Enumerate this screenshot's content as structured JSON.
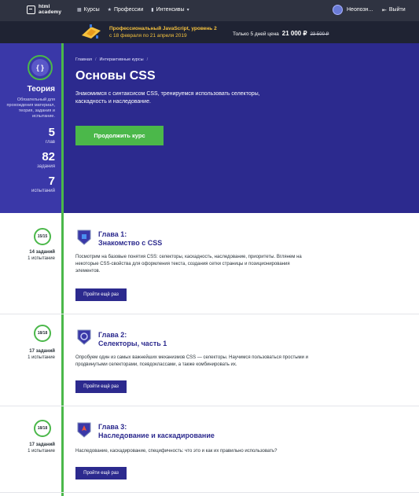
{
  "nav": {
    "logo_line1": "html",
    "logo_line2": "academy",
    "links": [
      {
        "label": "Курсы",
        "icon": "grid-icon"
      },
      {
        "label": "Профессии",
        "icon": "star-icon"
      },
      {
        "label": "Интенсивы",
        "icon": "bookmark-icon",
        "has_dropdown": true
      }
    ],
    "user_name": "Неопозн...",
    "logout_label": "Выйти"
  },
  "promo": {
    "title": "Профессиональный JavaScript, уровень 2",
    "dates": "с 18 февраля по 21 апреля 2019",
    "offer_text": "Только 5 дней цена",
    "price": "21 000 ₽",
    "old_price": "23 500 ₽"
  },
  "theory": {
    "badge": "{ }",
    "title": "Теория",
    "description": "Обязательный для прохождения материал, теория, задания и испытание.",
    "stats": [
      {
        "value": "5",
        "label": "глав"
      },
      {
        "value": "82",
        "label": "задания"
      },
      {
        "value": "7",
        "label": "испытаний"
      }
    ]
  },
  "hero": {
    "breadcrumbs": [
      "Главная",
      "Интерактивные курсы"
    ],
    "title": "Основы CSS",
    "description": "Знакомимся с синтаксисом CSS, тренируемся использовать селекторы, каскадность и наследование.",
    "continue_label": "Продолжить курс"
  },
  "chapters": [
    {
      "progress": "15/15",
      "tasks": "14 заданий",
      "tests": "1 испытание",
      "number": "Глава 1:",
      "name": "Знакомство с CSS",
      "description": "Посмотрим на базовые понятия CSS: селекторы, каскадность, наследование, приоритеты. Вглянем на некоторые CSS-свойства для оформления текста, создания сетки страницы и позиционирования элементов.",
      "button": "Пройти ещё раз",
      "icon": "html5-shield-icon"
    },
    {
      "progress": "18/18",
      "tasks": "17 заданий",
      "tests": "1 испытание",
      "number": "Глава 2:",
      "name": "Селекторы, часть 1",
      "description": "Опробуем один из самых важнейших механизмов CSS — селекторы. Научимся пользоваться простыми и продвинутыми селекторами, псевдоклассами, а также комбинировать их.",
      "button": "Пройти ещё раз",
      "icon": "target-shield-icon"
    },
    {
      "progress": "18/18",
      "tasks": "17 заданий",
      "tests": "1 испытание",
      "number": "Глава 3:",
      "name": "Наследование и каскадирование",
      "description": "Наследование, каскадирование, специфичность: что это и как их правильно использовать?",
      "button": "Пройти ещё раз",
      "icon": "rocket-shield-icon"
    }
  ]
}
